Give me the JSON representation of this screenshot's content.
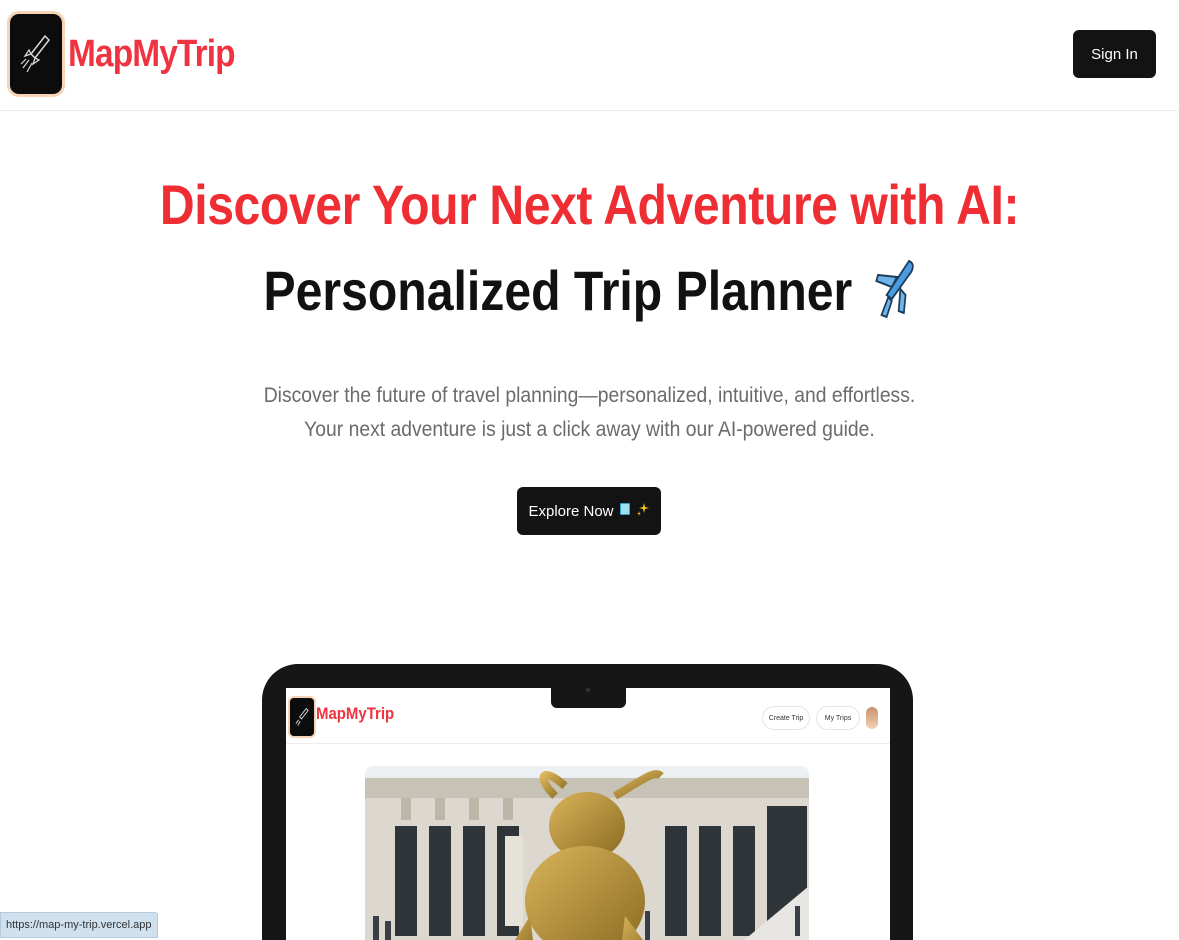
{
  "header": {
    "brand": "MapMyTrip",
    "signin_label": "Sign In"
  },
  "hero": {
    "title_line1": "Discover Your Next Adventure with AI:",
    "title_line2": "Personalized Trip Planner",
    "title_emoji": "airplane-icon",
    "subtitle_line1": "Discover the future of travel planning—personalized, intuitive, and effortless.",
    "subtitle_line2": "Your next adventure is just a click away with our AI-powered guide.",
    "cta_label": "Explore Now",
    "cta_icons": [
      "book-icon",
      "sparkles-icon"
    ]
  },
  "preview": {
    "brand": "MapMyTrip",
    "nav": [
      "Create Trip",
      "My Trips"
    ]
  },
  "status_bar": {
    "url": "https://map-my-trip.vercel.app"
  },
  "colors": {
    "accent": "#ef3340",
    "button_dark": "#131313",
    "subtitle": "#6b6b6b"
  }
}
